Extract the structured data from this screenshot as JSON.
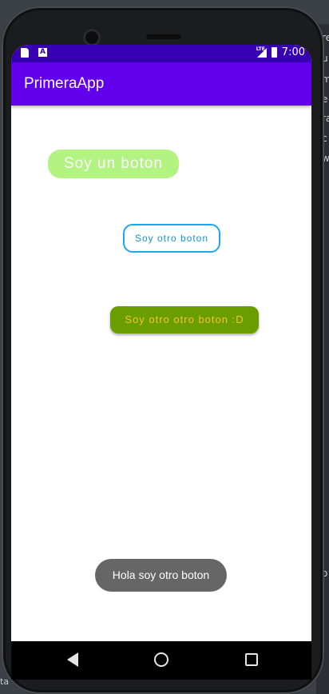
{
  "status_bar": {
    "time": "7:00",
    "network_label": "LTE",
    "left_icons": [
      "sd-card-icon",
      "a-notification-icon"
    ],
    "right_icons": [
      "signal-icon",
      "battery-icon"
    ]
  },
  "app_bar": {
    "title": "PrimeraApp",
    "color": "#6200ee"
  },
  "buttons": {
    "button1_label": "Soy un boton",
    "button2_label": "Soy otro boton",
    "button3_label": "Soy otro otro boton :D"
  },
  "toast": {
    "message": "Hola soy otro boton"
  },
  "navigation_bar": {
    "icons": [
      "back-icon",
      "home-icon",
      "recent-apps-icon"
    ]
  },
  "colors": {
    "status_bar": "#3700b3",
    "button1_bg": "#b2f381",
    "button2_border": "#1fa6ea",
    "button3_bg": "#6a9e00",
    "button3_text": "#f7c22c",
    "toast_bg": "#666666"
  },
  "ide_background": {
    "right_chars": [
      "re",
      "u",
      "m",
      "e",
      "ra",
      "c",
      "w",
      "o"
    ],
    "bottom_text": "ta"
  }
}
